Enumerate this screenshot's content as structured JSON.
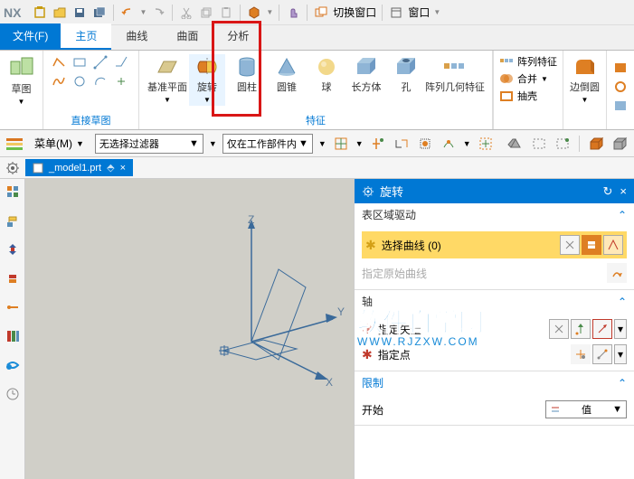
{
  "app": {
    "name": "NX"
  },
  "titlebar": {
    "switch_window": "切换窗口",
    "window": "窗口"
  },
  "tabs": {
    "file": "文件(F)",
    "home": "主页",
    "curve": "曲线",
    "surface": "曲面",
    "analysis": "分析"
  },
  "ribbon": {
    "sketch": {
      "label": "草图",
      "group": "直接草图"
    },
    "feature_group": "特征",
    "datum_plane": "基准平面",
    "revolve": "旋转",
    "cylinder": "圆柱",
    "cone": "圆锥",
    "sphere": "球",
    "box": "长方体",
    "hole": "孔",
    "pattern_geo": "阵列几何特征",
    "pattern_feat": "阵列特征",
    "unite": "合并",
    "shell": "抽壳",
    "blend": "边倒圆"
  },
  "filter": {
    "menu": "菜单(M)",
    "no_filter": "无选择过滤器",
    "within_part": "仅在工作部件内"
  },
  "model_tab": "_model1.prt",
  "axis": {
    "x": "X",
    "y": "Y",
    "z": "Z"
  },
  "panel": {
    "title": "旋转",
    "section_drive": "表区域驱动",
    "select_curve": "选择曲线 (0)",
    "original_curve": "指定原始曲线",
    "axis_section": "轴",
    "specify_vector": "指定矢量",
    "specify_point": "指定点",
    "limit": "限制",
    "start": "开始",
    "value": "值"
  },
  "watermark": {
    "main": "软件自学网",
    "sub": "WWW.RJZXW.COM"
  }
}
